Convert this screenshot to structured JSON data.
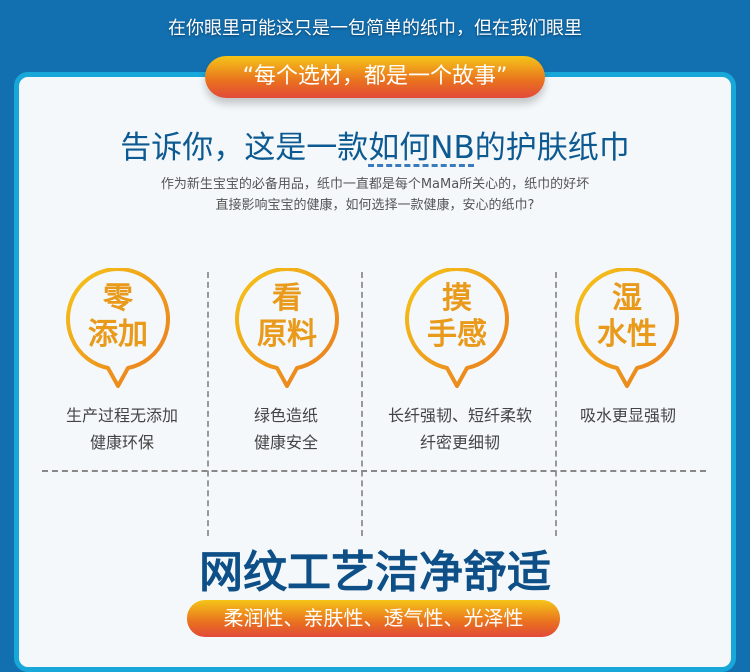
{
  "header": {
    "tagline": "在你眼里可能这只是一包简单的纸巾，但在我们眼里",
    "quote": "“每个选材，都是一个故事”"
  },
  "intro": {
    "title_a": "告诉你，这是一款",
    "title_b": "如何NB",
    "title_c": "的护肤纸巾",
    "line1": "作为新生宝宝的必备用品，纸巾一直都是每个MaMa所关心的，纸巾的好坏",
    "line2": "直接影响宝宝的健康，如何选择一款健康，安心的纸巾?"
  },
  "features": [
    {
      "line1": "零",
      "line2": "添加",
      "cap1": "生产过程无添加",
      "cap2": "健康环保"
    },
    {
      "line1": "看",
      "line2": "原料",
      "cap1": "绿色造纸",
      "cap2": "健康安全"
    },
    {
      "line1": "摸",
      "line2": "手感",
      "cap1": "长纤强韧、短纤柔软",
      "cap2": "纤密更细韧"
    },
    {
      "line1": "湿",
      "line2": "水性",
      "cap1": "吸水更显强韧",
      "cap2": ""
    }
  ],
  "section2": {
    "title": "网纹工艺洁净舒适",
    "tags": "柔润性、亲肤性、透气性、光泽性"
  },
  "colors": {
    "bg": "#1270b0",
    "accent": "#e99a1a",
    "title": "#0d5a92"
  }
}
